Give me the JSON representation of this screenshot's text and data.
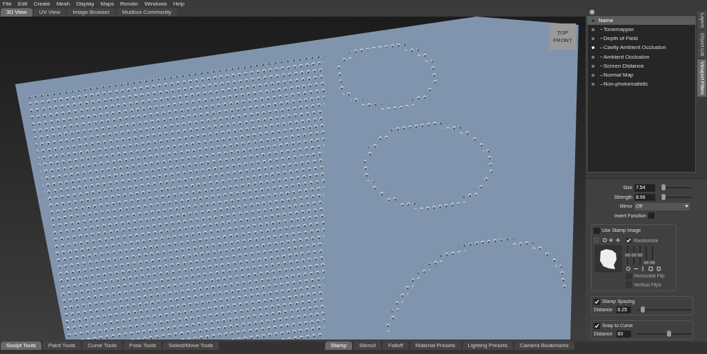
{
  "menu": [
    "File",
    "Edit",
    "Create",
    "Mesh",
    "Display",
    "Maps",
    "Render",
    "Windows",
    "Help"
  ],
  "view_tabs": [
    {
      "label": "3D View",
      "selected": true
    },
    {
      "label": "UV View",
      "selected": false
    },
    {
      "label": "Image Browser",
      "selected": false
    },
    {
      "label": "Mudbox Community",
      "selected": false
    }
  ],
  "viewcube": {
    "top": "TOP",
    "front": "FRONT"
  },
  "filters": {
    "header": "Name",
    "items": [
      {
        "label": "Tonemapper",
        "on": false
      },
      {
        "label": "Depth of Field",
        "on": false
      },
      {
        "label": "Cavity Ambient Occlusion",
        "on": true
      },
      {
        "label": "Ambient Occlusion",
        "on": false
      },
      {
        "label": "Screen Distance",
        "on": false
      },
      {
        "label": "Normal Map",
        "on": false
      },
      {
        "label": "Non-photorealistic",
        "on": false
      }
    ]
  },
  "side_tabs": [
    {
      "label": "Layers",
      "selected": false
    },
    {
      "label": "Object List",
      "selected": false
    },
    {
      "label": "Viewport Filters",
      "selected": true
    }
  ],
  "properties": {
    "sliders": [
      {
        "label": "Size",
        "value": "7.54",
        "level": 0.1
      },
      {
        "label": "Strength",
        "value": "8.96",
        "level": 0.1
      }
    ],
    "mirror": {
      "label": "Mirror",
      "value": "Off"
    },
    "invert": {
      "label": "Invert Function",
      "checked": false
    },
    "stamp": {
      "label": "Use Stamp Image",
      "checked": false,
      "randomize": {
        "label": "Randomize",
        "checked": true
      },
      "levels": [
        {
          "level": 0.5
        },
        {
          "level": 0.5
        },
        {
          "level": 0.5
        },
        {
          "level": 0.1
        },
        {
          "level": 0.1
        }
      ],
      "flips": [
        {
          "label": "Horizontal Flip",
          "checked": false
        },
        {
          "label": "Vertical Flips",
          "checked": false
        }
      ]
    },
    "groups": [
      {
        "label": "Stamp Spacing",
        "checked": true,
        "field": "Distance",
        "value": "6.25",
        "level": 0.1
      },
      {
        "label": "Snap to Curve",
        "checked": true,
        "field": "Distance",
        "value": "60",
        "level": 0.6
      }
    ]
  },
  "tool_tabs": [
    {
      "label": "Sculpt Tools",
      "selected": true
    },
    {
      "label": "Paint Tools",
      "selected": false
    },
    {
      "label": "Curve Tools",
      "selected": false
    },
    {
      "label": "Pose Tools",
      "selected": false
    },
    {
      "label": "Select/Move Tools",
      "selected": false
    }
  ],
  "tray_tabs": [
    {
      "label": "Stamp",
      "selected": true
    },
    {
      "label": "Stencil",
      "selected": false
    },
    {
      "label": "Falloff",
      "selected": false
    },
    {
      "label": "Material Presets",
      "selected": false
    },
    {
      "label": "Lighting Presets",
      "selected": false
    },
    {
      "label": "Camera Bookmarks",
      "selected": false
    }
  ]
}
